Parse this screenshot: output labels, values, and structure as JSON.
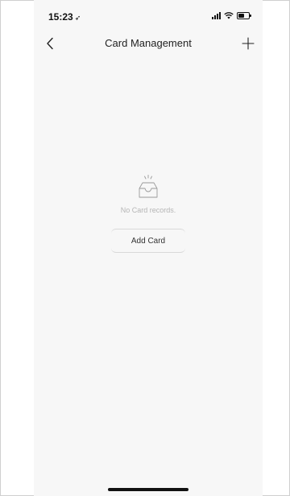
{
  "status_bar": {
    "time": "15:23",
    "location_icon": "location-arrow-icon",
    "signal_icon": "signal-icon",
    "wifi_icon": "wifi-icon",
    "battery_icon": "battery-icon",
    "battery_level": 0.6
  },
  "header": {
    "title": "Card Management",
    "back_icon": "chevron-left-icon",
    "add_icon": "plus-icon"
  },
  "empty_state": {
    "icon": "empty-tray-icon",
    "message": "No Card records.",
    "button_label": "Add Card"
  },
  "colors": {
    "background": "#f7f7f7",
    "text_primary": "#222222",
    "text_muted": "#b5b5b5",
    "divider": "#d9d9d9"
  }
}
